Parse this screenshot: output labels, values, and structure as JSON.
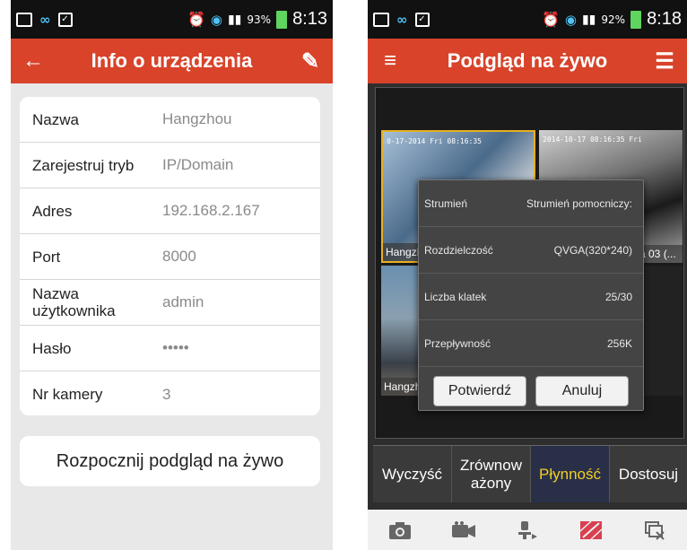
{
  "phone1": {
    "status": {
      "battery": "93%",
      "time": "8:13"
    },
    "title": "Info o urządzenia",
    "back_icon": "back-arrow-icon",
    "edit_icon": "edit-pencil-icon",
    "rows": [
      {
        "label": "Nazwa",
        "value": "Hangzhou"
      },
      {
        "label": "Zarejestruj tryb",
        "value": "IP/Domain"
      },
      {
        "label": "Adres",
        "value": "192.168.2.167"
      },
      {
        "label": "Port",
        "value": "8000"
      },
      {
        "label": "Nazwa użytkownika",
        "value": "admin"
      },
      {
        "label": "Hasło",
        "value": "•••••"
      },
      {
        "label": "Nr kamery",
        "value": "3"
      }
    ],
    "live_button": "Rozpocznij podgląd na żywo"
  },
  "phone2": {
    "status": {
      "battery": "92%",
      "time": "8:18"
    },
    "title": "Podgląd na żywo",
    "tiles": [
      {
        "label": "Hangzh",
        "osd": "0-17-2014 Fri 08:16:35"
      },
      {
        "label": "a 03 (...",
        "osd": "2014-10-17 08:16:35 Fri"
      },
      {
        "label": "Hangzh",
        "osd": ""
      }
    ],
    "dialog": {
      "rows": [
        {
          "label": "Strumień",
          "value": "Strumień pomocniczy:"
        },
        {
          "label": "Rozdzielczość",
          "value": "QVGA(320*240)"
        },
        {
          "label": "Liczba klatek",
          "value": "25/30"
        },
        {
          "label": "Przepływność",
          "value": "256K"
        }
      ],
      "confirm": "Potwierdź",
      "cancel": "Anuluj"
    },
    "tabs": [
      {
        "label": "Wyczyść"
      },
      {
        "label": "Zrównow ażony"
      },
      {
        "label": "Płynność"
      },
      {
        "label": "Dostosuj"
      }
    ],
    "accent": "#f0d020",
    "bottom_icons": [
      "camera-icon",
      "video-record-icon",
      "ptz-icon",
      "stop-all-icon",
      "close-window-icon"
    ]
  },
  "colors": {
    "titlebar": "#d8432a",
    "battery": "#5fd45f"
  }
}
